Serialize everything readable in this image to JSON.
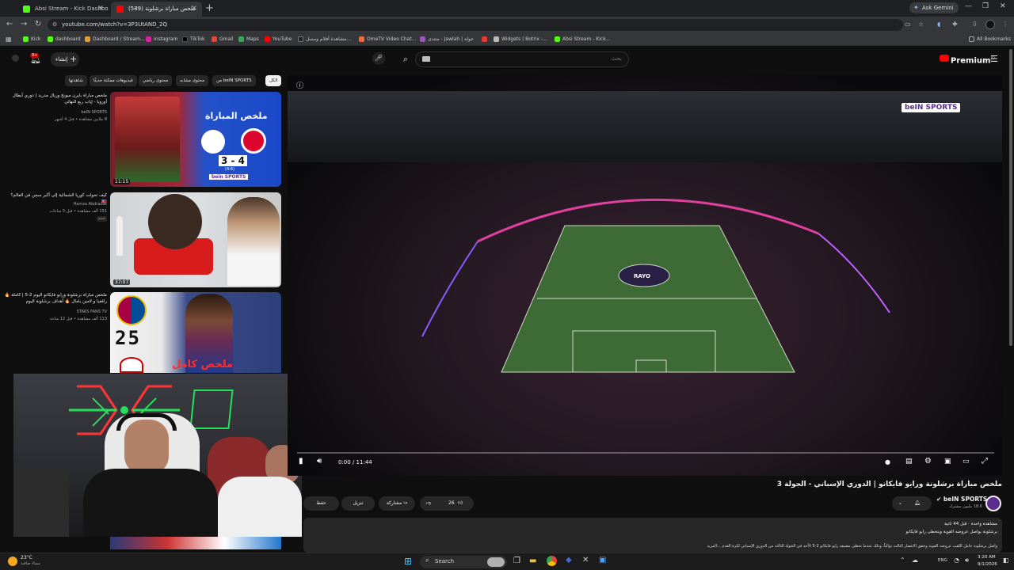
{
  "browser": {
    "tabs": [
      {
        "title": "Absi Stream - Kick Dashboard",
        "active": false
      },
      {
        "title": "ملخص مباراة برشلونة (589)",
        "active": true
      }
    ],
    "ask_gemini": "Ask Gemini",
    "url": "youtube.com/watch?v=3P3UtAND_2Q",
    "all_bookmarks": "All Bookmarks",
    "bookmarks": [
      "Kick",
      "dashboard",
      "Dashboard / Stream...",
      "instagram",
      "TikTok",
      "Gmail",
      "Maps",
      "YouTube",
      "مشاهدة أفلام ومسل...",
      "OmeTV Video Chat...",
      "منتدى - Jawlah | جولة",
      "Widgets | Botrix -...",
      "Absi Stream - Kick..."
    ]
  },
  "youtube": {
    "logo": "Premium",
    "logo_region": "JO",
    "create_label": "إنشاء",
    "search_placeholder": "بحث",
    "notification_count": "9+",
    "chips": [
      {
        "label": "الكل",
        "selected": true
      },
      {
        "label": "من beIN SPORTS",
        "selected": false
      },
      {
        "label": "محتوى مشابه",
        "selected": false
      },
      {
        "label": "محتوى رياضي",
        "selected": false
      },
      {
        "label": "فيديوهات ممكنة حديثًا",
        "selected": false
      },
      {
        "label": "شاهدتها",
        "selected": false
      }
    ],
    "recommendations": [
      {
        "title": "ملخص مباراة بايرن ميونخ وريال مدريد | دوري أبطال أوروبا - إياب ربع النهائي",
        "channel": "beIN SPORTS",
        "meta": "8 ملايين مشاهدة • قبل 4 أشهر",
        "duration": "11:15",
        "thumb_title": "ملخص المباراة",
        "score": "3 - 4",
        "score_sub": "(4-6)",
        "badge": "bein SPORTS"
      },
      {
        "title": "كيف تحولت كوريا الشمالية إلى أكبر سجن في العالم؟ 🇰🇵",
        "channel": "Hamza Abdrazak",
        "meta": "151 ألف مشاهدة • قبل 5 ساعات",
        "duration": "37:07",
        "badge_new": "جديد"
      },
      {
        "title": "ملخص مباراة برشلونة ورايو فايكانو اليوم 2-5 | كاملة 🔥 راففيا و لامين يامال 🔥 أهداف برشلونة اليوم",
        "channel": "STARS FANS TV",
        "meta": "113 ألف مشاهدة • قبل 12 ساعة",
        "score_top": "2",
        "score_bottom": "5",
        "thumb_text": "ملخص كامل"
      }
    ],
    "video": {
      "title": "ملخص مباراة برشلونة ورايو فايكانو | الدوري الإسباني - الجولة 3",
      "time_current": "0:00",
      "time_total": "11:44",
      "watermark": "beIN SPORTS",
      "center_logo": "RAYO"
    },
    "channel": {
      "name": "beIN SPORTS",
      "subscribers": "18.6 مليون مشترك"
    },
    "actions": {
      "likes": "26",
      "share": "مشاركة",
      "download": "تنزيل",
      "save": "حفظ"
    },
    "description": {
      "line1_views": "مشاهدة واحدة",
      "line1_age": "قبل 44 ثانية",
      "line2": "برشلونة يواصل عروضه القوية ويتخطى رايو فايكانو",
      "line3": "واصل برشلونة حامل اللقب عروضه القوية وحقق الانتصار الثالث توالياً، وذلك عندما تخطى مضيفه رايو فايكانو 2-5 الأحد في الجولة الثالثة من الدوري الإسباني لكرة القدم ...المزيد"
    }
  },
  "taskbar": {
    "weather_temp": "23°C",
    "weather_desc": "سماء صافية",
    "search": "Search",
    "language": "ENG",
    "time": "3:20 AM",
    "date": "9/1/2026"
  },
  "colors": {
    "youtube_red": "#ff0000",
    "bein_purple": "#5b2d8e",
    "chrome_dark": "#35363a"
  }
}
